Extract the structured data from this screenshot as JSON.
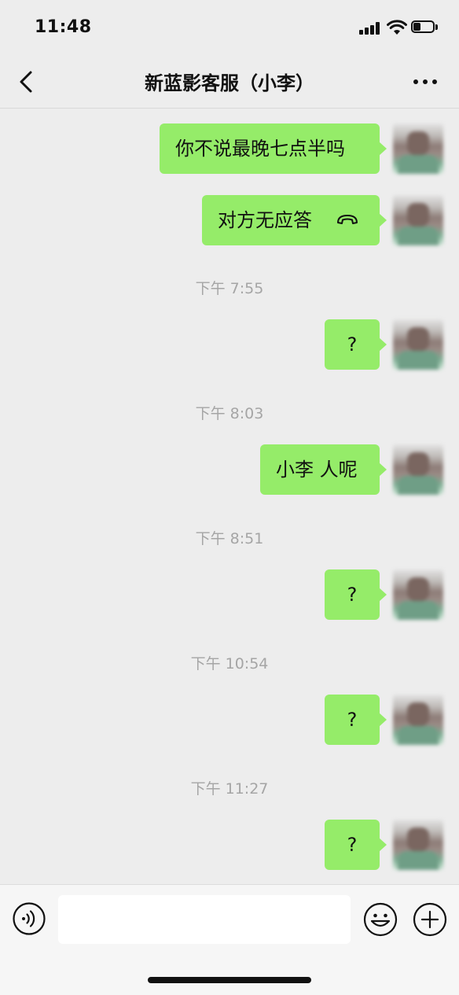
{
  "status_bar": {
    "time": "11:48"
  },
  "nav": {
    "title": "新蓝影客服（小李）"
  },
  "messages": [
    {
      "text": "你不说最晚七点半吗"
    },
    {
      "text": "对方无应答"
    },
    {
      "timestamp": "下午 7:55"
    },
    {
      "text": "?"
    },
    {
      "timestamp": "下午 8:03"
    },
    {
      "text": "小李 人呢"
    },
    {
      "timestamp": "下午 8:51"
    },
    {
      "text": "?"
    },
    {
      "timestamp": "下午 10:54"
    },
    {
      "text": "?"
    },
    {
      "timestamp": "下午 11:27"
    },
    {
      "text": "?"
    }
  ],
  "input": {
    "value": ""
  },
  "colors": {
    "bubble": "#95ec69",
    "background": "#ededed"
  },
  "icons": [
    "back-icon",
    "more-icon",
    "hangup-icon",
    "voice-icon",
    "emoji-icon",
    "plus-icon"
  ]
}
